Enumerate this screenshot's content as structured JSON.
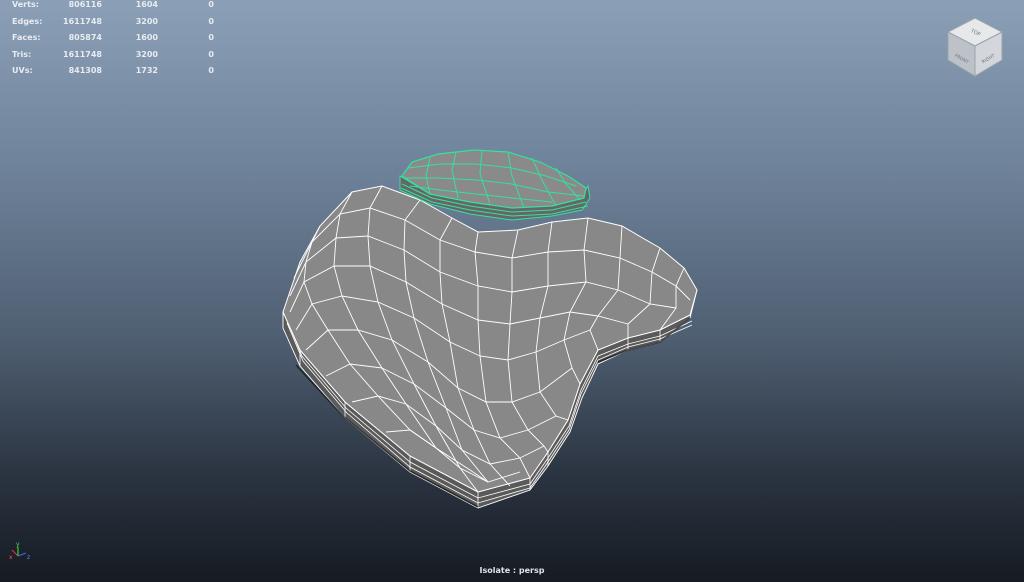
{
  "hud": {
    "rows": [
      {
        "label": "Verts:",
        "total": "806116",
        "selected": "1604",
        "components": "0"
      },
      {
        "label": "Edges:",
        "total": "1611748",
        "selected": "3200",
        "components": "0"
      },
      {
        "label": "Faces:",
        "total": "805874",
        "selected": "1600",
        "components": "0"
      },
      {
        "label": "Tris:",
        "total": "1611748",
        "selected": "3200",
        "components": "0"
      },
      {
        "label": "UVs:",
        "total": "841308",
        "selected": "1732",
        "components": "0"
      }
    ]
  },
  "viewcube": {
    "top_label": "TOP",
    "front_label": "FRONT",
    "right_label": "RIGHT"
  },
  "axis": {
    "x": "x",
    "y": "y",
    "z": "z"
  },
  "footer": {
    "camera_label": "Isolate : persp"
  },
  "colors": {
    "mesh_face": "#878787",
    "mesh_side": "#5e5e5e",
    "wireframe": "#ffffff",
    "selection": "#35e0a0",
    "background_top": "#8b9fb7",
    "background_bottom": "#161b22"
  }
}
